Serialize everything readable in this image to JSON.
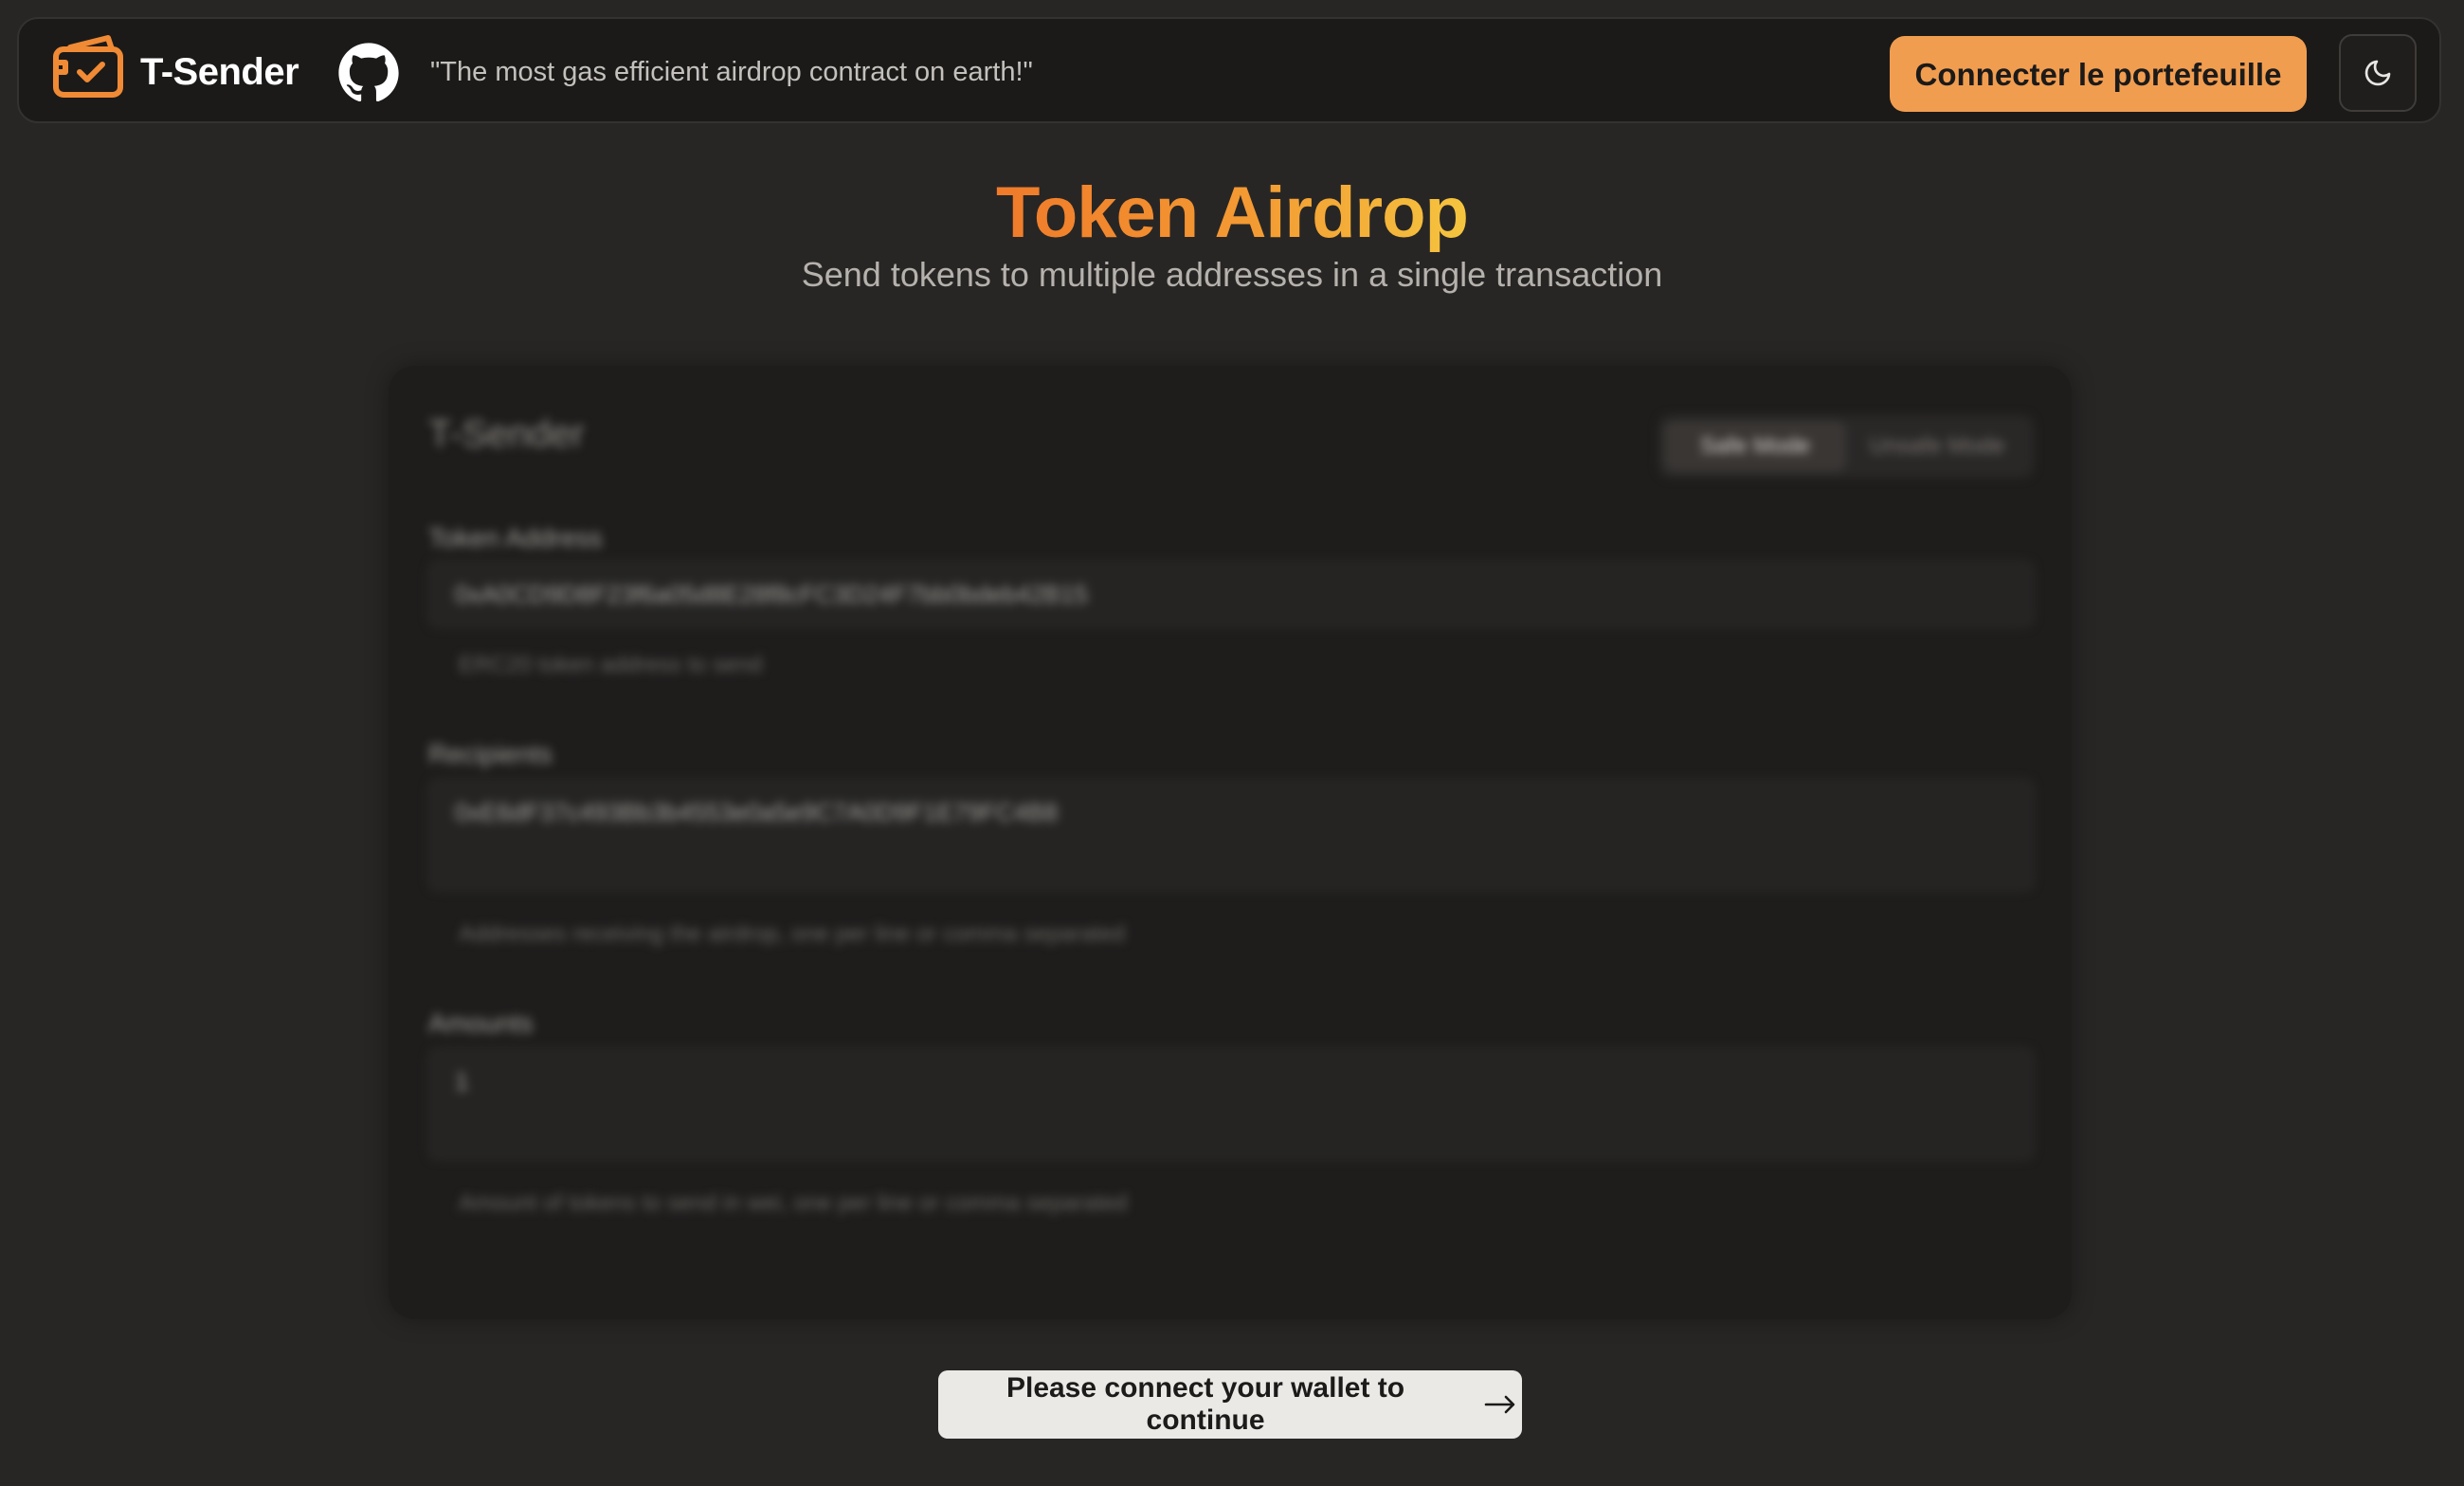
{
  "header": {
    "brand": "T-Sender",
    "tagline": "\"The most gas efficient airdrop contract on earth!\"",
    "connect_label": "Connecter le portefeuille",
    "icons": {
      "logo": "wallet-check-icon",
      "github": "github-icon",
      "theme": "moon-icon"
    }
  },
  "hero": {
    "title": "Token Airdrop",
    "subtitle": "Send tokens to multiple addresses in a single transaction"
  },
  "form": {
    "title": "T-Sender",
    "modes": [
      "Safe Mode",
      "Unsafe Mode"
    ],
    "active_mode": "Safe Mode",
    "token_address": {
      "label": "Token Address",
      "value": "0xA0CD9D8F23f6a05d8E28f8cFC3D24F7bb0bdeb42B15",
      "help": "ERC20 token address to send"
    },
    "recipients": {
      "label": "Recipients",
      "value": "0xE6dF37c493Bb3b4553e0a5e9C7A0D9F1E79FC4B8",
      "help": "Addresses receiving the airdrop, one per line or comma separated"
    },
    "amounts": {
      "label": "Amounts",
      "value": "1",
      "help": "Amount of tokens to send in wei, one per line or comma separated"
    }
  },
  "footer_action": {
    "label": "Please connect your wallet to continue",
    "icon": "arrow-right-icon"
  },
  "colors": {
    "accent": "#f19d50",
    "background": "#282625",
    "panel": "#1b1a19"
  }
}
